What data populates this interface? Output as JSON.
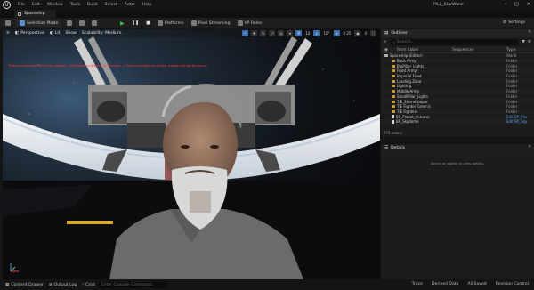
{
  "menubar": {
    "logo": "U",
    "items": [
      "File",
      "Edit",
      "Window",
      "Tools",
      "Build",
      "Select",
      "Actor",
      "Help"
    ],
    "project": "PILL_StarWarsI",
    "controls": [
      "–",
      "□",
      "✕"
    ]
  },
  "tab": {
    "label": "Spaceship"
  },
  "toolbar": {
    "mode": "Selection Mode",
    "platforms": "Platforms",
    "pixel_streaming": "Pixel Streaming",
    "vp_roles": "VP Roles",
    "settings": "Settings"
  },
  "viewport": {
    "perspective": "Perspective",
    "lit": "Lit",
    "show": "Show",
    "scalability": "Scalability: Medium",
    "grid_value": "10",
    "angle_value": "10°",
    "scale_value": "0.25",
    "speed_value": "4",
    "warning": "Texture streaming pool over budget... MipMapping skipped at Sample(...) Texture budget exceeded, please see performance"
  },
  "outliner": {
    "title": "Outliner",
    "search_placeholder": "Search...",
    "col_label": "Item Label",
    "col_sequence": "Sequencer",
    "col_type": "Type",
    "rows": [
      {
        "label": "Spaceship (Editor)",
        "type": "World",
        "kind": "root"
      },
      {
        "label": "Back Army",
        "type": "Folder",
        "kind": "folder"
      },
      {
        "label": "BigPillar_Lights",
        "type": "Folder",
        "kind": "folder"
      },
      {
        "label": "Front Army",
        "type": "Folder",
        "kind": "folder"
      },
      {
        "label": "Imperial Fleet",
        "type": "Folder",
        "kind": "folder"
      },
      {
        "label": "Landing Zone",
        "type": "Folder",
        "kind": "folder"
      },
      {
        "label": "Lighting",
        "type": "Folder",
        "kind": "folder"
      },
      {
        "label": "Middle Army",
        "type": "Folder",
        "kind": "folder"
      },
      {
        "label": "SmallPillar_Lights",
        "type": "Folder",
        "kind": "folder"
      },
      {
        "label": "TIE_Stormtrooper",
        "type": "Folder",
        "kind": "folder"
      },
      {
        "label": "TIE Fighter Green's",
        "type": "Folder",
        "kind": "folder"
      },
      {
        "label": "TIE Fighters",
        "type": "Folder",
        "kind": "folder"
      },
      {
        "label": "BP_Planet_Volcanic",
        "type": "Edit BP_Plar",
        "kind": "file"
      },
      {
        "label": "BP_Skydome",
        "type": "Edit BP_Sky",
        "kind": "file"
      }
    ],
    "count": "775 actors"
  },
  "details": {
    "title": "Details",
    "empty_message": "Select an object to view details."
  },
  "statusbar": {
    "content_drawer": "Content Drawer",
    "output_log": "Output Log",
    "cmd": "Cmd",
    "cmd_placeholder": "Enter Console Command",
    "trace": "Trace",
    "derived_data": "Derived Data",
    "all_saved": "All Saved",
    "revision_control": "Revision Control"
  },
  "colors": {
    "accent": "#3b6eaa",
    "play": "#46c04b",
    "folder": "#c89b3c",
    "warning": "#ff3030"
  }
}
